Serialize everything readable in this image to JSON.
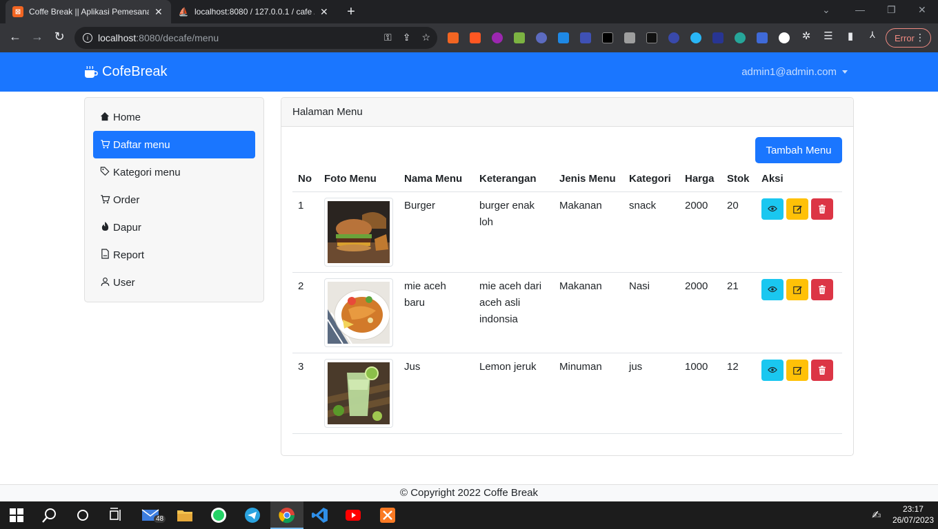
{
  "browser": {
    "tabs": [
      {
        "title": "Coffe Break || Aplikasi Pemesanan",
        "active": true
      },
      {
        "title": "localhost:8080 / 127.0.0.1 / cafe /",
        "active": false
      }
    ],
    "url_host": "localhost",
    "url_rest": ":8080/decafe/menu",
    "error_label": "Error"
  },
  "navbar": {
    "brand": "CofeBreak",
    "user": "admin1@admin.com"
  },
  "sidebar": {
    "items": [
      {
        "label": "Home",
        "icon": "house-icon"
      },
      {
        "label": "Daftar menu",
        "icon": "cart-icon",
        "active": true
      },
      {
        "label": "Kategori menu",
        "icon": "tags-icon"
      },
      {
        "label": "Order",
        "icon": "cart-icon"
      },
      {
        "label": "Dapur",
        "icon": "fire-icon"
      },
      {
        "label": "Report",
        "icon": "file-icon"
      },
      {
        "label": "User",
        "icon": "person-icon"
      }
    ]
  },
  "main": {
    "header": "Halaman Menu",
    "add_button": "Tambah Menu",
    "columns": [
      "No",
      "Foto Menu",
      "Nama Menu",
      "Keterangan",
      "Jenis Menu",
      "Kategori",
      "Harga",
      "Stok",
      "Aksi"
    ],
    "rows": [
      {
        "no": "1",
        "photo": "burger-photo",
        "nama": "Burger",
        "keterangan": "burger enak loh",
        "jenis": "Makanan",
        "kategori": "snack",
        "harga": "2000",
        "stok": "20"
      },
      {
        "no": "2",
        "photo": "mie-aceh-photo",
        "nama": "mie aceh baru",
        "keterangan": "mie aceh dari aceh asli indonsia",
        "jenis": "Makanan",
        "kategori": "Nasi",
        "harga": "2000",
        "stok": "21"
      },
      {
        "no": "3",
        "photo": "jus-photo",
        "nama": "Jus",
        "keterangan": "Lemon jeruk",
        "jenis": "Minuman",
        "kategori": "jus",
        "harga": "1000",
        "stok": "12"
      }
    ]
  },
  "footer": {
    "text": "© Copyright 2022 Coffe Break"
  },
  "taskbar": {
    "time": "23:17",
    "date": "26/07/2023",
    "mail_badge": "48"
  },
  "colors": {
    "primary": "#1a76ff",
    "info": "#1ac7f0",
    "warning": "#ffc107",
    "danger": "#dc3545"
  }
}
